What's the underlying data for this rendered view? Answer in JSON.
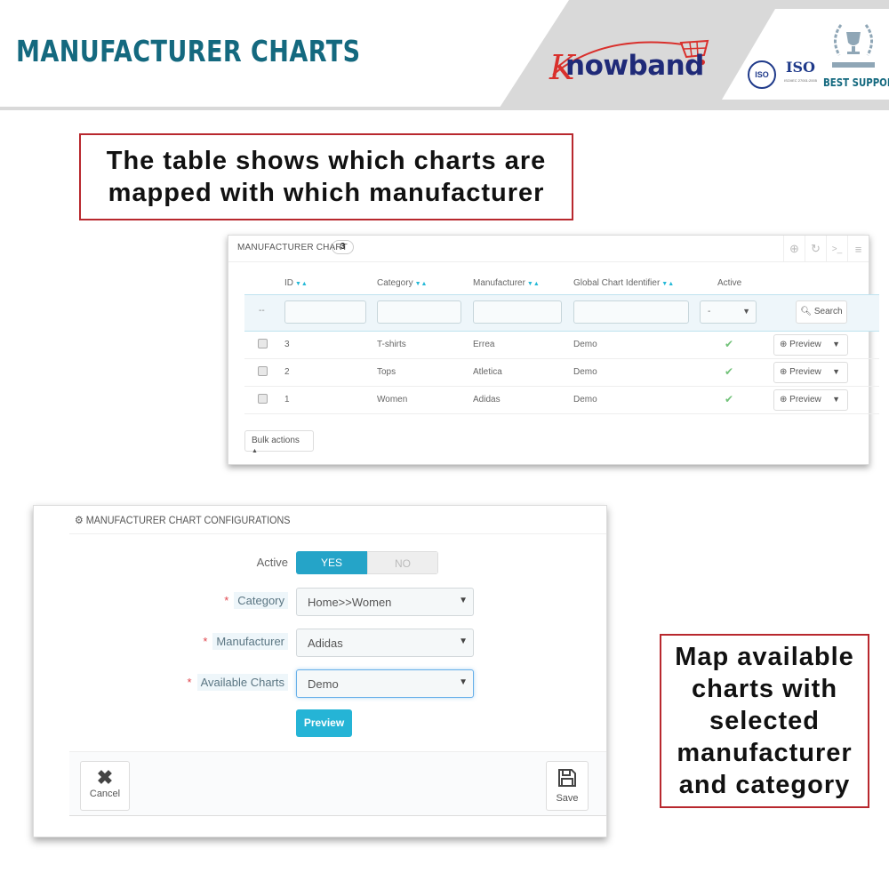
{
  "header": {
    "title": "MANUFACTURER CHARTS",
    "logo_text": "nowband",
    "logo_initial": "K",
    "badges": [
      "ISO",
      "ISO"
    ],
    "iso_subtext": "ISO/IEC 27001:2005",
    "best_support": "BEST SUPPORT"
  },
  "callouts": {
    "table_note": "The table shows which charts are mapped with which manufacturer",
    "form_note": "Map available charts with selected manufacturer and category"
  },
  "table_panel": {
    "title": "MANUFACTURER CHART",
    "count": "3",
    "toolbar_icons": [
      "add-icon",
      "refresh-icon",
      "sql-query-icon",
      "database-icon"
    ],
    "columns": [
      {
        "label": "ID",
        "sortable": true
      },
      {
        "label": "Category",
        "sortable": true
      },
      {
        "label": "Manufacturer",
        "sortable": true
      },
      {
        "label": "Global Chart Identifier",
        "sortable": true
      },
      {
        "label": "Active",
        "sortable": false
      }
    ],
    "filters": {
      "dash": "--",
      "id": "",
      "category": "",
      "manufacturer": "",
      "global_chart_identifier": "",
      "active_selected": "-"
    },
    "search_label": "Search",
    "rows": [
      {
        "id": "3",
        "category": "T-shirts",
        "manufacturer": "Errea",
        "identifier": "Demo",
        "active": true,
        "action": "Preview"
      },
      {
        "id": "2",
        "category": "Tops",
        "manufacturer": "Atletica",
        "identifier": "Demo",
        "active": true,
        "action": "Preview"
      },
      {
        "id": "1",
        "category": "Women",
        "manufacturer": "Adidas",
        "identifier": "Demo",
        "active": true,
        "action": "Preview"
      }
    ],
    "bulk_actions_label": "Bulk actions"
  },
  "config_panel": {
    "title": "MANUFACTURER CHART CONFIGURATIONS",
    "active_label": "Active",
    "active_yes": "YES",
    "active_no": "NO",
    "active_value": "YES",
    "category_label": "Category",
    "category_value": "Home>>Women",
    "manufacturer_label": "Manufacturer",
    "manufacturer_value": "Adidas",
    "charts_label": "Available Charts",
    "charts_value": "Demo",
    "preview_label": "Preview",
    "cancel_label": "Cancel",
    "save_label": "Save"
  },
  "colors": {
    "title_teal": "#14697f",
    "accent_blue": "#25b4d6",
    "callout_border": "#b8282e",
    "check_green": "#72c279",
    "required_red": "#e0464e"
  }
}
